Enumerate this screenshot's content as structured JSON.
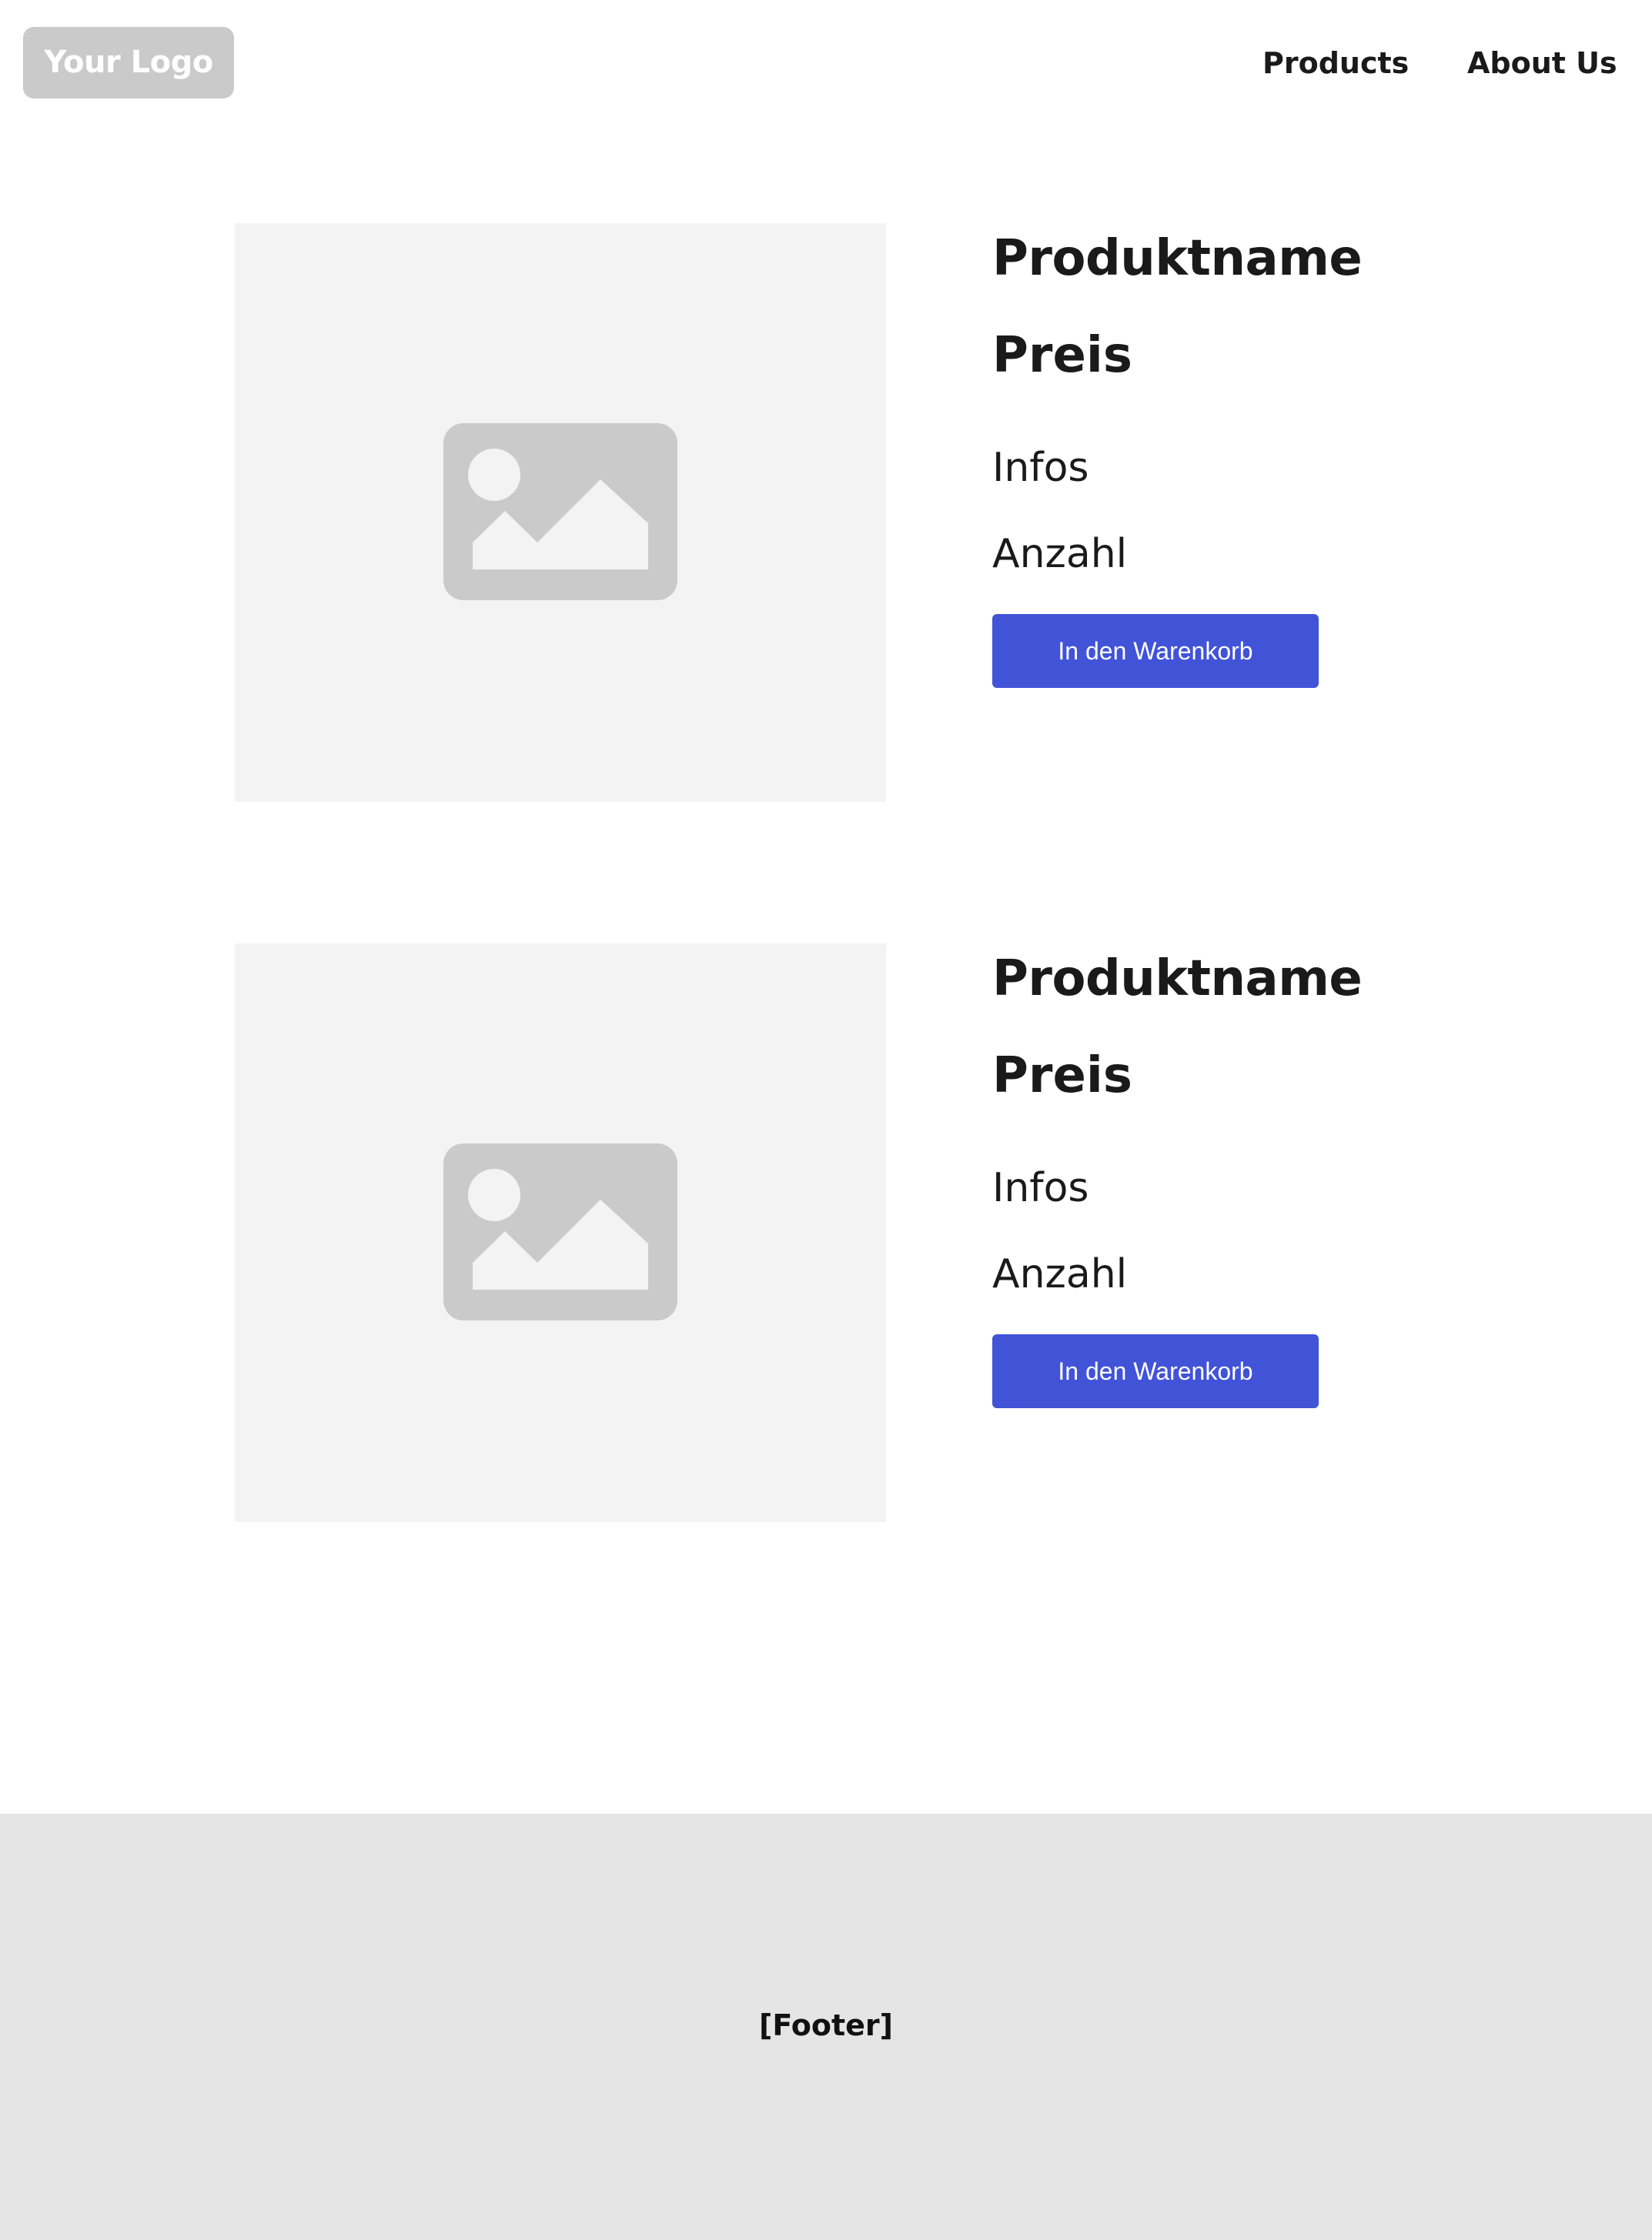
{
  "header": {
    "logo_text": "Your Logo",
    "nav": [
      {
        "label": "Products"
      },
      {
        "label": "About Us"
      }
    ]
  },
  "products": [
    {
      "name": "Produktname",
      "price": "Preis",
      "info": "Infos",
      "quantity": "Anzahl",
      "button_label": "In den Warenkorb",
      "image_icon": "image-placeholder-icon"
    },
    {
      "name": "Produktname",
      "price": "Preis",
      "info": "Infos",
      "quantity": "Anzahl",
      "button_label": "In den Warenkorb",
      "image_icon": "image-placeholder-icon"
    }
  ],
  "footer": {
    "text": "[Footer]"
  },
  "colors": {
    "accent": "#4153d7",
    "logo_bg": "#cacaca",
    "image_bg": "#f3f3f3",
    "footer_bg": "#e5e5e5"
  }
}
